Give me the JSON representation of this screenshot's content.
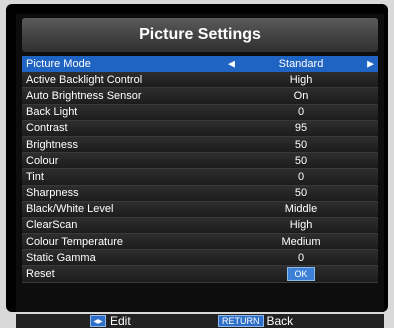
{
  "menu": {
    "title": "Picture Settings",
    "rows": [
      {
        "label": "Picture Mode",
        "value": "Standard"
      },
      {
        "label": "Active Backlight Control",
        "value": "High"
      },
      {
        "label": "Auto Brightness Sensor",
        "value": "On"
      },
      {
        "label": "Back Light",
        "value": "0"
      },
      {
        "label": "Contrast",
        "value": "95"
      },
      {
        "label": "Brightness",
        "value": "50"
      },
      {
        "label": "Colour",
        "value": "50"
      },
      {
        "label": "Tint",
        "value": "0"
      },
      {
        "label": "Sharpness",
        "value": "50"
      },
      {
        "label": "Black/White Level",
        "value": "Middle"
      },
      {
        "label": "ClearScan",
        "value": "High"
      },
      {
        "label": "Colour Temperature",
        "value": "Medium"
      },
      {
        "label": "Static Gamma",
        "value": "0"
      },
      {
        "label": "Reset",
        "value": "OK"
      }
    ]
  },
  "footer": {
    "edit_label": "Edit",
    "return_key": "RETURN",
    "back_label": "Back"
  },
  "colors": {
    "selected_row": "#1f63c3",
    "ok_badge": "#3b7fd6"
  },
  "icons": {
    "arrow_left": "left-arrow-icon",
    "arrow_right": "right-arrow-icon",
    "edit_hint": "left-right-keys-icon"
  }
}
